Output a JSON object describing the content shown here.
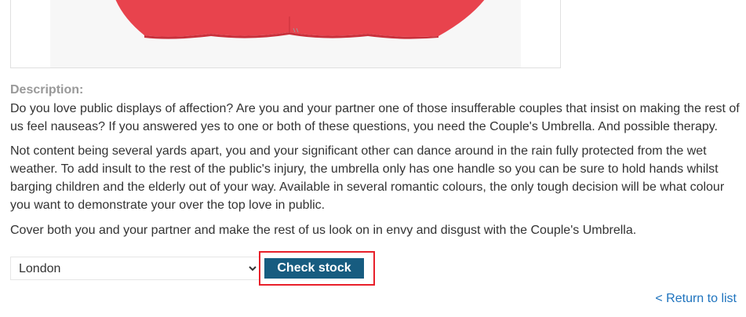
{
  "product": {
    "image_alt": "Couple's Umbrella",
    "image_colors": {
      "canopy": "#e8434d",
      "canopy_dark": "#c9303b",
      "background": "#f7f7f7"
    }
  },
  "description": {
    "label": "Description:",
    "paragraphs": [
      "Do you love public displays of affection? Are you and your partner one of those insufferable couples that insist on making the rest of us feel nauseas? If you answered yes to one or both of these questions, you need the Couple's Umbrella. And possible therapy.",
      "Not content being several yards apart, you and your significant other can dance around in the rain fully protected from the wet weather. To add insult to the rest of the public's injury, the umbrella only has one handle so you can be sure to hold hands whilst barging children and the elderly out of your way. Available in several romantic colours, the only tough decision will be what colour you want to demonstrate your over the top love in public.",
      "Cover both you and your partner and make the rest of us look on in envy and disgust with the Couple's Umbrella."
    ]
  },
  "stock": {
    "selected_store": "London",
    "check_button_label": "Check stock"
  },
  "navigation": {
    "return_link": "< Return to list"
  },
  "colors": {
    "button_bg": "#175c80",
    "highlight_border": "#e8202a",
    "link": "#1e73be",
    "label": "#999999"
  }
}
